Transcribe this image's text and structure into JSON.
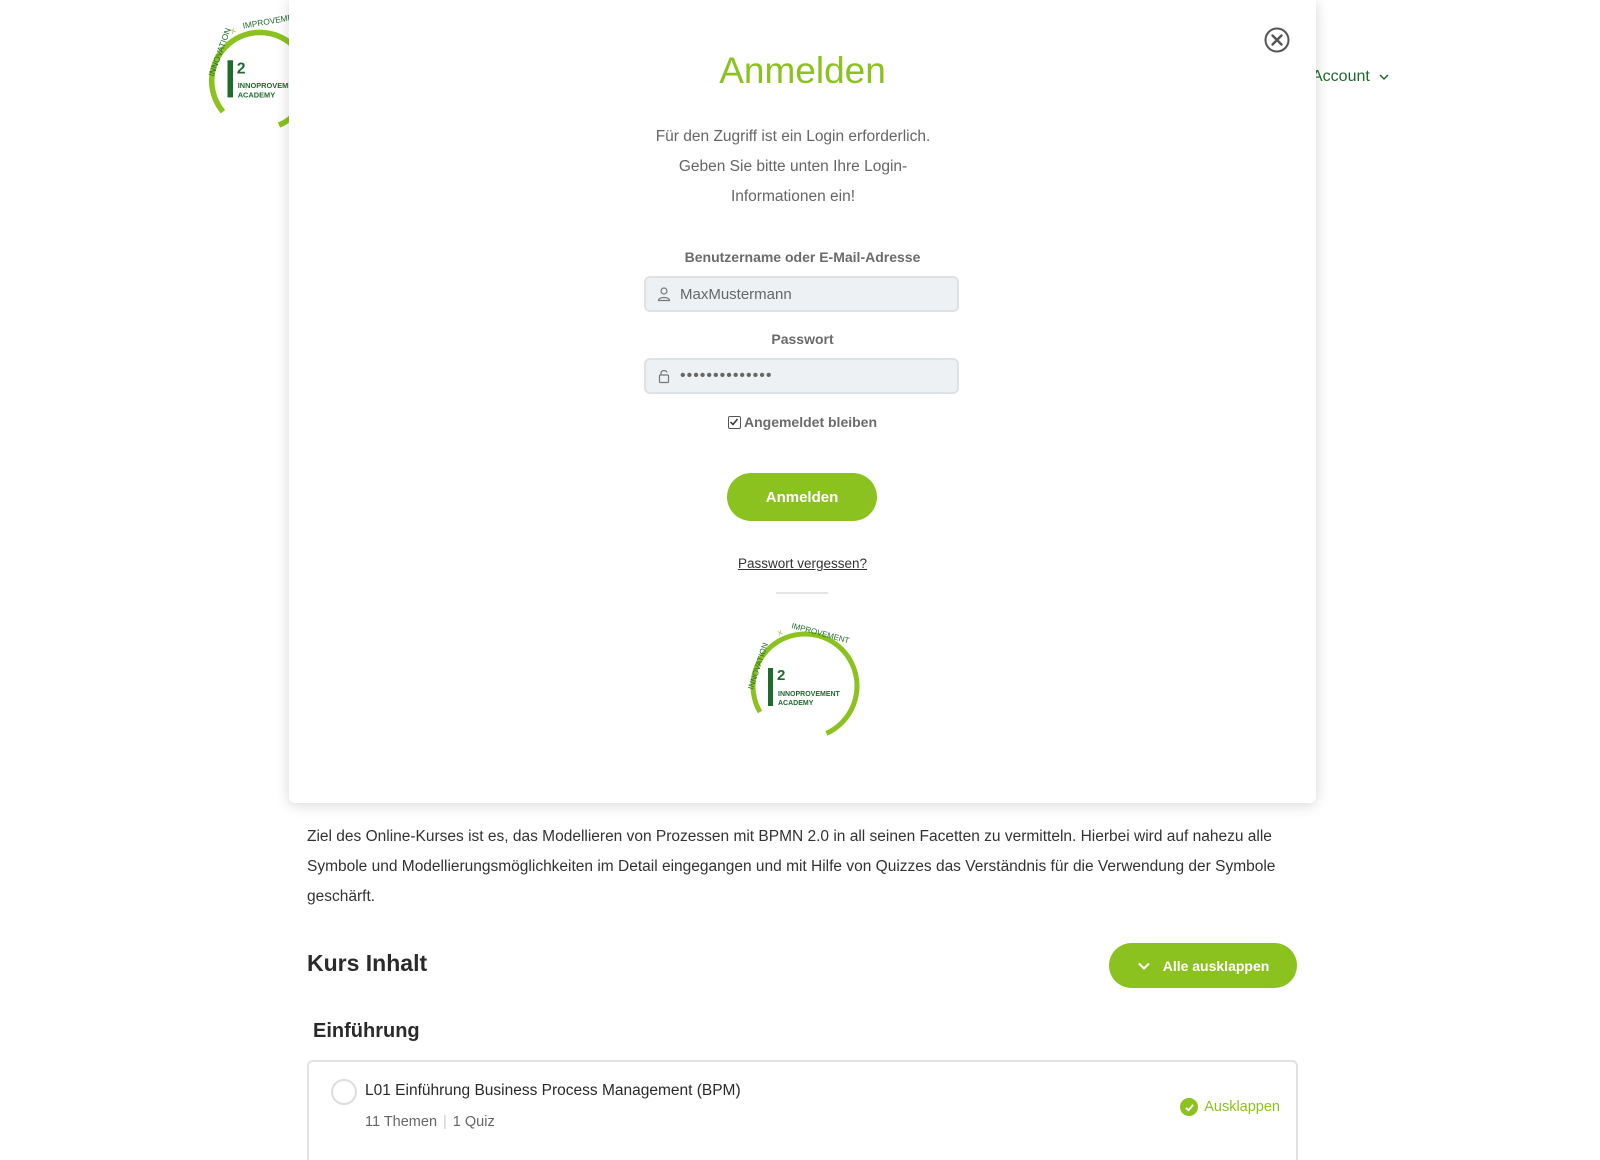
{
  "site": {
    "nav_account_label": "Account",
    "logo": {
      "arc_text_left": "INNOVATION",
      "arc_text_x": "X",
      "arc_text_right": "IMPROVEMENT",
      "letter": "I",
      "superscript": "2",
      "name_line1": "INNOPROVEMENT",
      "name_line2": "ACADEMY"
    }
  },
  "modal": {
    "title": "Anmelden",
    "intro_line1": "Für den Zugriff ist ein Login erforderlich.",
    "intro_line2": "Geben Sie bitte unten Ihre Login-",
    "intro_line3": "Informationen ein!",
    "username_label": "Benutzername oder E-Mail-Adresse",
    "username_value": "MaxMustermann",
    "password_label": "Passwort",
    "password_value": "••••••••••••••",
    "remember_label": "Angemeldet bleiben",
    "remember_checked": true,
    "submit_label": "Anmelden",
    "forgot_label": "Passwort vergessen?"
  },
  "course": {
    "description": "Ziel des Online-Kurses ist es, das Modellieren von Prozessen mit BPMN 2.0 in all seinen Facetten zu vermitteln. Hierbei wird auf nahezu alle Symbole und Modellierungsmöglichkeiten im Detail eingegangen und mit Hilfe von Quizzes das Verständnis für die Verwendung der Symbole geschärft.",
    "content_heading": "Kurs Inhalt",
    "expand_all_label": "Alle ausklappen",
    "section_title": "Einführung",
    "lessons": [
      {
        "title": "L01 Einführung Business Process Management (BPM)",
        "topics": "11 Themen",
        "quiz": "1 Quiz",
        "expand_label": "Ausklappen"
      }
    ]
  },
  "colors": {
    "accent": "#8cc21f",
    "dark_green": "#1e6b2d",
    "text": "#333333",
    "muted": "#666666"
  }
}
